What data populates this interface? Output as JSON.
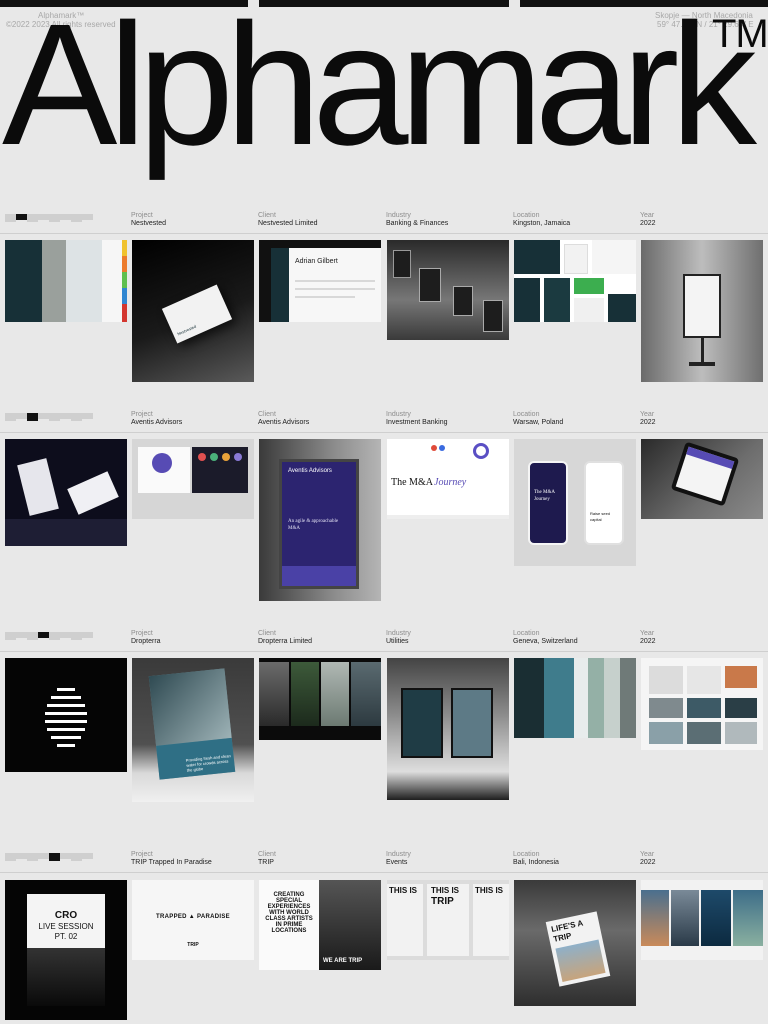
{
  "header": {
    "brand_small": "Alphamark™",
    "copyright": "©2022 2023 All rights reserved",
    "location": "Skopje — North Macedonia",
    "coords": "59° 47.26\" N / 21° 29.64\" E",
    "wordmark": "Alphamark",
    "tm": "TM"
  },
  "labels": {
    "project": "Project",
    "client": "Client",
    "industry": "Industry",
    "location": "Location",
    "year": "Year"
  },
  "projects": [
    {
      "project": "Nestvested",
      "client": "Nestvested Limited",
      "industry": "Banking & Finances",
      "location": "Kingston, Jamaica",
      "year": "2022",
      "active_index": 1
    },
    {
      "project": "Aventis Advisors",
      "client": "Aventis Advisors",
      "industry": "Investment Banking",
      "location": "Warsaw, Poland",
      "year": "2022",
      "active_index": 2
    },
    {
      "project": "Dropterra",
      "client": "Dropterra Limited",
      "industry": "Utilities",
      "location": "Geneva, Switzerland",
      "year": "2022",
      "active_index": 3
    },
    {
      "project": "TRIP Trapped In Paradise",
      "client": "TRIP",
      "industry": "Events",
      "location": "Bali, Indonesia",
      "year": "2022",
      "active_index": 4
    }
  ],
  "tiles": {
    "nest_card_text": "Nestvested",
    "nest_profile_name": "Adrian Gilbert",
    "aventis_sign": "Aventis Advisors",
    "aventis_tagline": "An agile & approachable M&A",
    "aventis_journey_a": "The M&A",
    "aventis_journey_b": "Journey",
    "aventis_phone_a": "The M&A Journey",
    "aventis_phone_b": "Raise seed capital",
    "dropterra_tagline": "Providing fresh and clean water for crowds across the globe",
    "cro_title": "CRO",
    "cro_line1": "LIVE SESSION",
    "cro_line2": "PT. 02",
    "trip_banner": "TRAPPED ▲ PARADISE",
    "trip_logo": "TRIP",
    "creating_text": "CREATING SPECIAL EXPERIENCES WITH WORLD CLASS ARTISTS IN PRIME LOCATIONS",
    "we_are_trip": "WE ARE TRIP",
    "this_is": "THIS IS",
    "lifes_a": "LIFE'S A",
    "lifes_trip": "TRIP"
  }
}
